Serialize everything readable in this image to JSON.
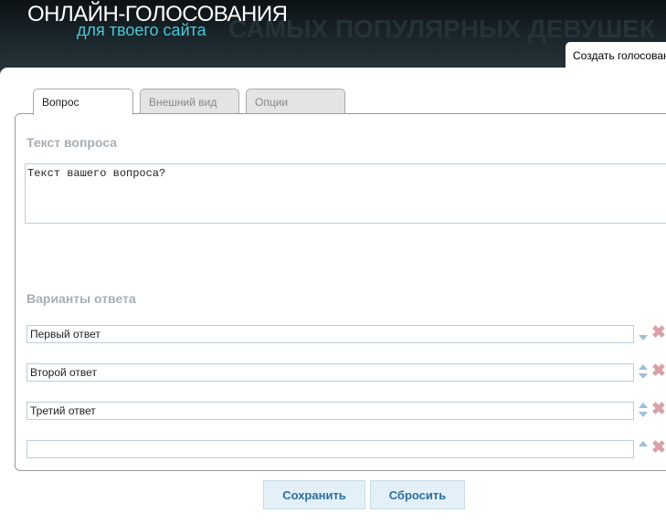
{
  "header": {
    "title": "ОНЛАЙН-ГОЛОСОВАНИЯ",
    "subtitle": "для твоего сайта",
    "background_text": "САМЫХ ПОПУЛЯРНЫХ ДЕВУШЕК",
    "create_tab": "Создать голосование"
  },
  "tabs": [
    {
      "label": "Вопрос",
      "active": true
    },
    {
      "label": "Внешний вид",
      "active": false
    },
    {
      "label": "Опции",
      "active": false
    }
  ],
  "question": {
    "label": "Текст вопроса",
    "value": "Текст вашего вопроса?"
  },
  "answers": {
    "label": "Варианты ответа",
    "items": [
      {
        "value": "Первый ответ"
      },
      {
        "value": "Второй ответ"
      },
      {
        "value": "Третий ответ"
      },
      {
        "value": ""
      }
    ]
  },
  "buttons": {
    "save": "Сохранить",
    "reset": "Сбросить"
  }
}
